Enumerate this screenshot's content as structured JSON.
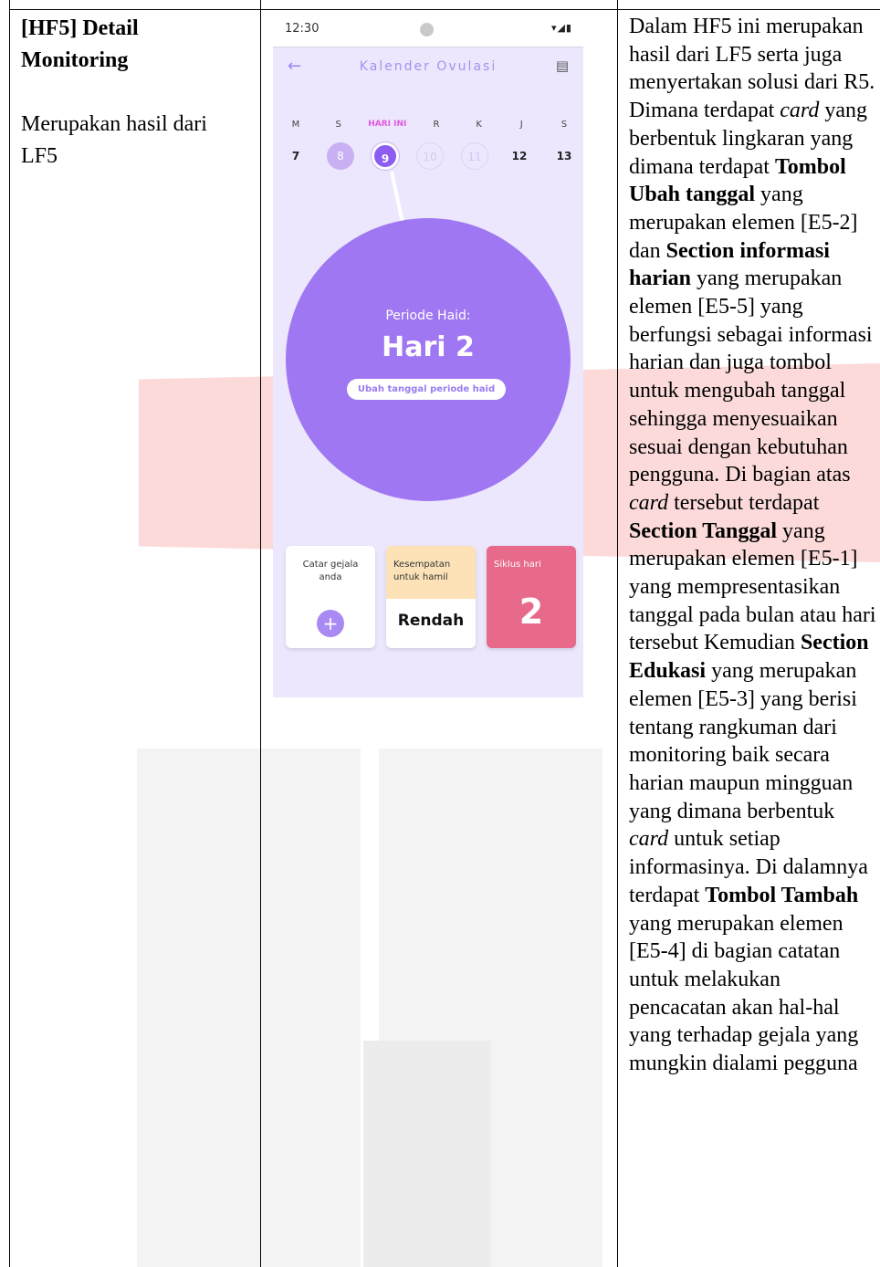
{
  "left": {
    "title": "[HF5] Detail Monitoring",
    "desc": "Merupakan hasil dari LF5"
  },
  "phone": {
    "status_time": "12:30",
    "app_title": "Kalender Ovulasi",
    "icons": {
      "back": "back-arrow-icon",
      "book": "book-icon"
    },
    "days": [
      "M",
      "S",
      "HARI INI",
      "R",
      "K",
      "J",
      "S"
    ],
    "dates": [
      "7",
      "8",
      "9",
      "10",
      "11",
      "12",
      "13"
    ],
    "period_label": "Periode Haid:",
    "period_value": "Hari 2",
    "change_button": "Ubah tanggal periode haid",
    "cards": {
      "symptom": "Catar gejala anda",
      "chance_label": "Kesempatan untuk hamil",
      "chance_value": "Rendah",
      "cycle_label": "Siklus hari",
      "cycle_value": "2"
    },
    "colors": {
      "accent": "#a077f2",
      "bg": "#ece7fd",
      "pink": "#e86a8a",
      "peach": "#fde2b8"
    }
  },
  "right": {
    "s1": "Dalam HF5 ini merupakan hasil dari LF5 serta juga menyertakan solusi dari R5. Dimana terdapat ",
    "e1": "card",
    "s2": " yang berbentuk lingkaran yang dimana terdapat ",
    "b1": "Tombol Ubah tanggal",
    "s3": " yang merupakan elemen [E5-2] dan ",
    "b2": "Section informasi harian",
    "s4": " yang merupakan elemen [E5-5] yang berfungsi sebagai informasi harian dan juga tombol untuk mengubah tanggal sehingga menyesuaikan sesuai dengan kebutuhan pengguna. Di bagian atas ",
    "e2": "card",
    "s5": " tersebut terdapat ",
    "b3": "Section Tanggal",
    "s6": " yang merupakan elemen [E5-1] yang mempresentasikan tanggal pada bulan atau hari tersebut Kemudian ",
    "b4": "Section Edukasi",
    "s7": " yang merupakan elemen [E5-3] yang berisi tentang rangkuman dari monitoring baik secara harian  maupun mingguan yang dimana berbentuk ",
    "e3": "card",
    "s8": " untuk setiap informasinya. Di dalamnya terdapat ",
    "b5": "Tombol Tambah",
    "s9": " yang merupakan elemen [E5-4] di bagian catatan untuk melakukan pencacatan akan hal-hal yang terhadap gejala yang mungkin dialami pegguna"
  }
}
